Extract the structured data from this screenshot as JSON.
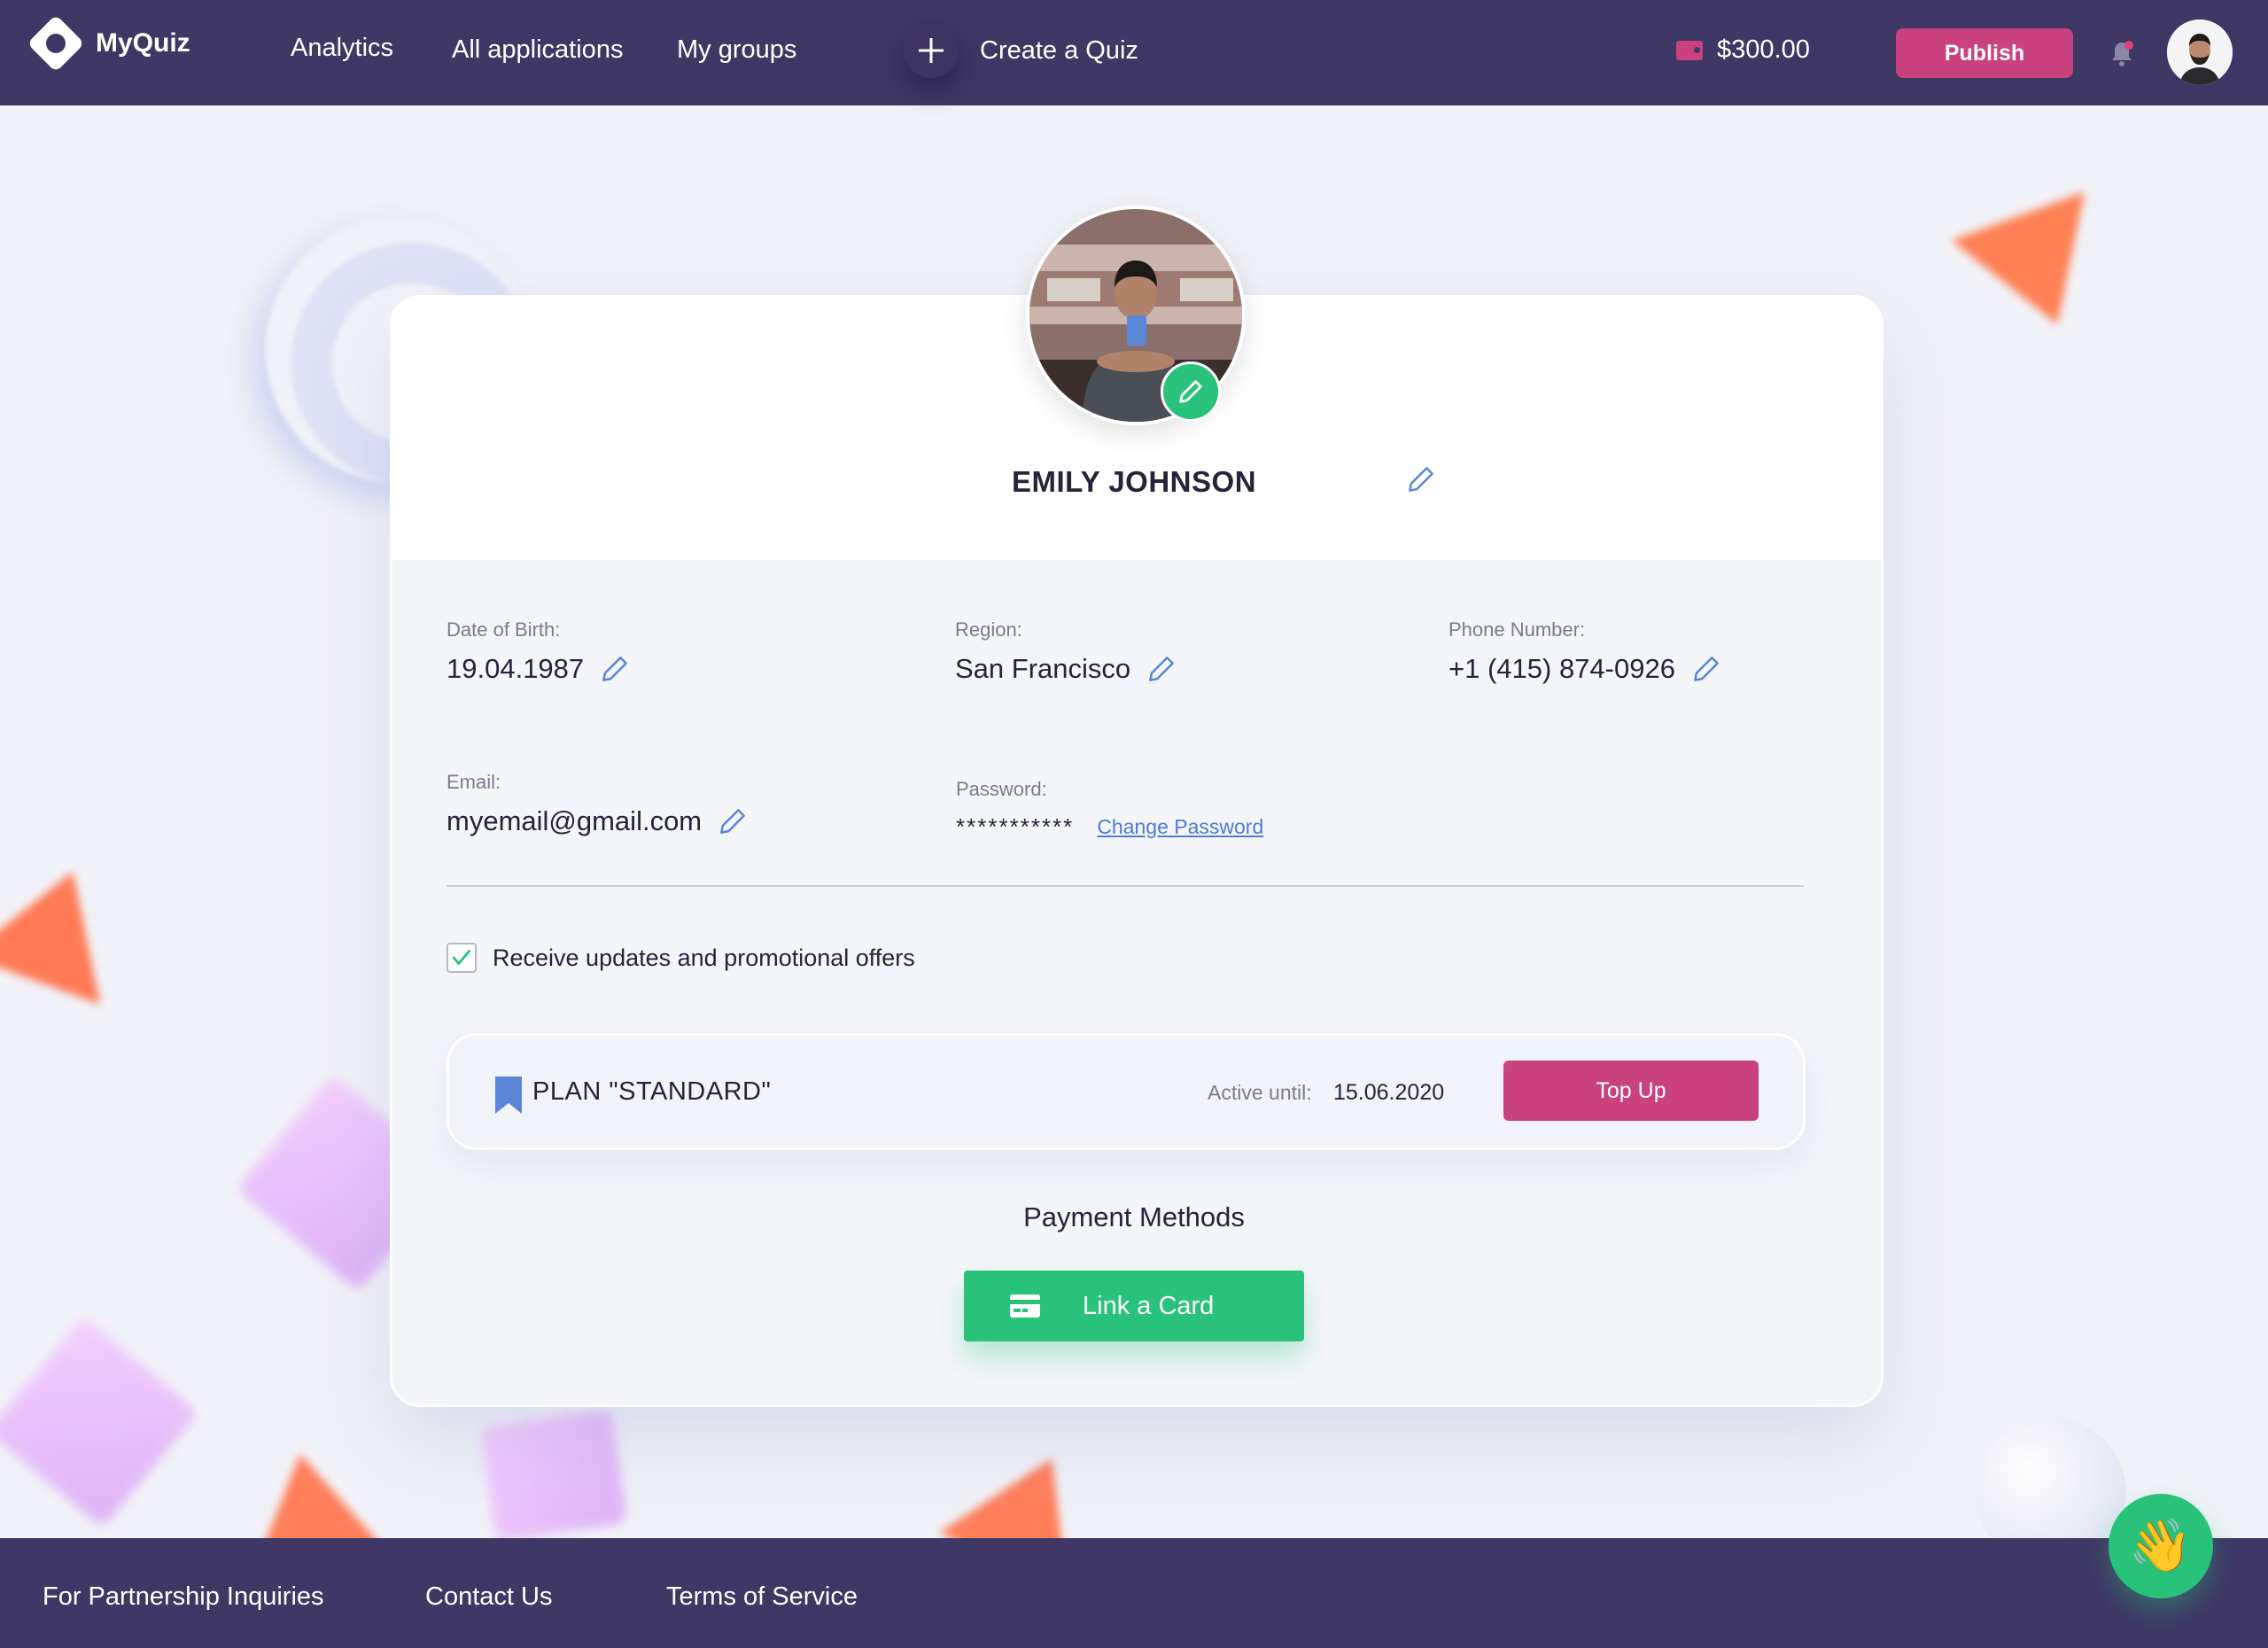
{
  "nav": {
    "logo": "MyQuiz",
    "links": [
      "Analytics",
      "All applications",
      "My groups"
    ],
    "create_label": "Create a Quiz",
    "balance": "$300.00",
    "publish_label": "Publish"
  },
  "profile": {
    "name": "EMILY JOHNSON",
    "fields": {
      "dob": {
        "label": "Date of Birth:",
        "value": "19.04.1987"
      },
      "region": {
        "label": "Region:",
        "value": "San Francisco"
      },
      "phone": {
        "label": "Phone Number:",
        "value": "+1 (415) 874-0926"
      },
      "email": {
        "label": "Email:",
        "value": "myemail@gmail.com"
      },
      "password": {
        "label": "Password:",
        "value": "***********",
        "change_label": "Change Password"
      }
    },
    "promo_checkbox": {
      "label": "Receive updates and promotional offers",
      "checked": true
    }
  },
  "plan": {
    "name": "PLAN \"STANDARD\"",
    "active_label": "Active until:",
    "active_date": "15.06.2020",
    "topup_label": "Top Up"
  },
  "payment": {
    "title": "Payment Methods",
    "link_card_label": "Link a Card"
  },
  "footer": {
    "links": [
      "For Partnership Inquiries",
      "Contact Us",
      "Terms of Service"
    ]
  },
  "colors": {
    "nav_bg": "#3f3764",
    "accent_pink": "#c9427d",
    "accent_green": "#29c27a",
    "link_blue": "#4c7bd6"
  },
  "icons": [
    "logo-icon",
    "plus-icon",
    "wallet-icon",
    "bell-icon",
    "pencil-icon",
    "checkmark-icon",
    "bookmark-icon",
    "credit-card-icon",
    "waving-hand-icon"
  ]
}
